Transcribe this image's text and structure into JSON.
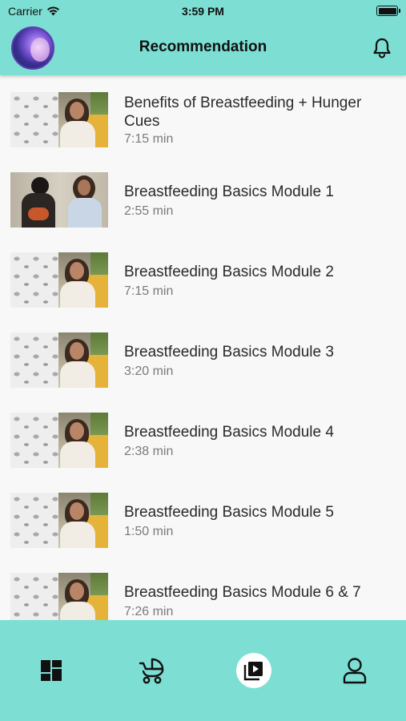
{
  "status_bar": {
    "carrier": "Carrier",
    "time": "3:59 PM"
  },
  "header": {
    "title": "Recommendation",
    "avatar_icon": "profile-photo",
    "notification_icon": "bell-icon"
  },
  "videos": [
    {
      "title": "Benefits of Breastfeeding + Hunger Cues",
      "duration": "7:15 min",
      "thumbnail": "instructor-portrait"
    },
    {
      "title": "Breastfeeding Basics Module 1",
      "duration": "2:55 min",
      "thumbnail": "two-women-with-baby"
    },
    {
      "title": "Breastfeeding Basics Module 2",
      "duration": "7:15 min",
      "thumbnail": "instructor-portrait"
    },
    {
      "title": "Breastfeeding Basics Module 3",
      "duration": "3:20 min",
      "thumbnail": "instructor-portrait"
    },
    {
      "title": "Breastfeeding Basics Module 4",
      "duration": "2:38 min",
      "thumbnail": "instructor-portrait"
    },
    {
      "title": "Breastfeeding Basics Module 5",
      "duration": "1:50 min",
      "thumbnail": "instructor-portrait"
    },
    {
      "title": "Breastfeeding Basics Module 6 & 7",
      "duration": "7:26 min",
      "thumbnail": "instructor-portrait"
    }
  ],
  "tabbar": {
    "tabs": [
      {
        "icon": "dashboard-icon",
        "active": false
      },
      {
        "icon": "stroller-icon",
        "active": false
      },
      {
        "icon": "video-library-icon",
        "active": true
      },
      {
        "icon": "profile-icon",
        "active": false
      }
    ]
  },
  "colors": {
    "accent": "#7dded3",
    "background": "#f8f8f8",
    "title_text": "#2a2a2a",
    "secondary_text": "#7a7a7a"
  }
}
